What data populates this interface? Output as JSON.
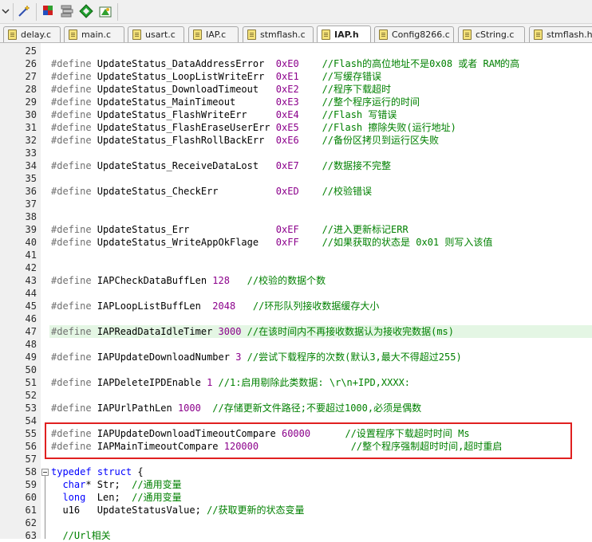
{
  "toolbar": {
    "icons": [
      "dropdown-arrow-icon",
      "magic-wand-icon",
      "download-flash-icon",
      "batch-build-icon",
      "green-diamond-icon",
      "manage-components-icon"
    ]
  },
  "tabs": [
    {
      "label": "delay.c",
      "active": false
    },
    {
      "label": "main.c",
      "active": false
    },
    {
      "label": "usart.c",
      "active": false
    },
    {
      "label": "IAP.c",
      "active": false
    },
    {
      "label": "stmflash.c",
      "active": false
    },
    {
      "label": "IAP.h",
      "active": true
    },
    {
      "label": "Config8266.c",
      "active": false
    },
    {
      "label": "cString.c",
      "active": false
    },
    {
      "label": "stmflash.h",
      "active": false
    }
  ],
  "editor": {
    "lines": [
      {
        "n": "25",
        "parts": []
      },
      {
        "n": "26",
        "parts": [
          [
            "pp",
            "#define "
          ],
          [
            "id",
            "UpdateStatus_DataAddressError  "
          ],
          [
            "nm",
            "0xE0"
          ],
          [
            "cm",
            "    //Flash的高位地址不是0x08 或者 RAM的高"
          ]
        ]
      },
      {
        "n": "27",
        "parts": [
          [
            "pp",
            "#define "
          ],
          [
            "id",
            "UpdateStatus_LoopListWriteErr  "
          ],
          [
            "nm",
            "0xE1"
          ],
          [
            "cm",
            "    //写缓存错误"
          ]
        ]
      },
      {
        "n": "28",
        "parts": [
          [
            "pp",
            "#define "
          ],
          [
            "id",
            "UpdateStatus_DownloadTimeout   "
          ],
          [
            "nm",
            "0xE2"
          ],
          [
            "cm",
            "    //程序下载超时"
          ]
        ]
      },
      {
        "n": "29",
        "parts": [
          [
            "pp",
            "#define "
          ],
          [
            "id",
            "UpdateStatus_MainTimeout       "
          ],
          [
            "nm",
            "0xE3"
          ],
          [
            "cm",
            "    //整个程序运行的时间"
          ]
        ]
      },
      {
        "n": "30",
        "parts": [
          [
            "pp",
            "#define "
          ],
          [
            "id",
            "UpdateStatus_FlashWriteErr     "
          ],
          [
            "nm",
            "0xE4"
          ],
          [
            "cm",
            "    //Flash 写错误"
          ]
        ]
      },
      {
        "n": "31",
        "parts": [
          [
            "pp",
            "#define "
          ],
          [
            "id",
            "UpdateStatus_FlashEraseUserErr "
          ],
          [
            "nm",
            "0xE5"
          ],
          [
            "cm",
            "    //Flash 擦除失败(运行地址)"
          ]
        ]
      },
      {
        "n": "32",
        "parts": [
          [
            "pp",
            "#define "
          ],
          [
            "id",
            "UpdateStatus_FlashRollBackErr  "
          ],
          [
            "nm",
            "0xE6"
          ],
          [
            "cm",
            "    //备份区拷贝到运行区失败"
          ]
        ]
      },
      {
        "n": "33",
        "parts": []
      },
      {
        "n": "34",
        "parts": [
          [
            "pp",
            "#define "
          ],
          [
            "id",
            "UpdateStatus_ReceiveDataLost   "
          ],
          [
            "nm",
            "0xE7"
          ],
          [
            "cm",
            "    //数据接不完整"
          ]
        ]
      },
      {
        "n": "35",
        "parts": []
      },
      {
        "n": "36",
        "parts": [
          [
            "pp",
            "#define "
          ],
          [
            "id",
            "UpdateStatus_CheckErr          "
          ],
          [
            "nm",
            "0xED"
          ],
          [
            "cm",
            "    //校验错误"
          ]
        ]
      },
      {
        "n": "37",
        "parts": []
      },
      {
        "n": "38",
        "parts": []
      },
      {
        "n": "39",
        "parts": [
          [
            "pp",
            "#define "
          ],
          [
            "id",
            "UpdateStatus_Err               "
          ],
          [
            "nm",
            "0xEF"
          ],
          [
            "cm",
            "    //进入更新标记ERR"
          ]
        ]
      },
      {
        "n": "40",
        "parts": [
          [
            "pp",
            "#define "
          ],
          [
            "id",
            "UpdateStatus_WriteAppOkFlage   "
          ],
          [
            "nm",
            "0xFF"
          ],
          [
            "cm",
            "    //如果获取的状态是 0x01 则写入该值"
          ]
        ]
      },
      {
        "n": "41",
        "parts": []
      },
      {
        "n": "42",
        "parts": []
      },
      {
        "n": "43",
        "parts": [
          [
            "pp",
            "#define "
          ],
          [
            "id",
            "IAPCheckDataBuffLen "
          ],
          [
            "nm",
            "128"
          ],
          [
            "cm",
            "   //校验的数据个数"
          ]
        ]
      },
      {
        "n": "44",
        "parts": []
      },
      {
        "n": "45",
        "parts": [
          [
            "pp",
            "#define "
          ],
          [
            "id",
            "IAPLoopListBuffLen  "
          ],
          [
            "nm",
            "2048"
          ],
          [
            "cm",
            "   //环形队列接收数据缓存大小"
          ]
        ]
      },
      {
        "n": "46",
        "parts": []
      },
      {
        "n": "47",
        "parts": [
          [
            "pp",
            "#define "
          ],
          [
            "id",
            "IAPReadDataIdleTimer "
          ],
          [
            "nm",
            "3000"
          ],
          [
            "cm",
            " //在该时间内不再接收数据认为接收完数据(ms)"
          ]
        ],
        "highlight": true
      },
      {
        "n": "48",
        "parts": []
      },
      {
        "n": "49",
        "parts": [
          [
            "pp",
            "#define "
          ],
          [
            "id",
            "IAPUpdateDownloadNumber "
          ],
          [
            "nm",
            "3"
          ],
          [
            "cm",
            " //尝试下载程序的次数(默认3,最大不得超过255)"
          ]
        ]
      },
      {
        "n": "50",
        "parts": []
      },
      {
        "n": "51",
        "parts": [
          [
            "pp",
            "#define "
          ],
          [
            "id",
            "IAPDeleteIPDEnable "
          ],
          [
            "nm",
            "1"
          ],
          [
            "cm",
            " //1:启用剔除此类数据: \\r\\n+IPD,XXXX:"
          ]
        ]
      },
      {
        "n": "52",
        "parts": []
      },
      {
        "n": "53",
        "parts": [
          [
            "pp",
            "#define "
          ],
          [
            "id",
            "IAPUrlPathLen "
          ],
          [
            "nm",
            "1000"
          ],
          [
            "cm",
            "  //存储更新文件路径;不要超过1000,必须是偶数"
          ]
        ]
      },
      {
        "n": "54",
        "parts": []
      },
      {
        "n": "55",
        "parts": [
          [
            "pp",
            "#define "
          ],
          [
            "id",
            "IAPUpdateDownloadTimeoutCompare "
          ],
          [
            "nm",
            "60000"
          ],
          [
            "cm",
            "      //设置程序下载超时时间 Ms"
          ]
        ]
      },
      {
        "n": "56",
        "parts": [
          [
            "pp",
            "#define "
          ],
          [
            "id",
            "IAPMainTimeoutCompare "
          ],
          [
            "nm",
            "120000"
          ],
          [
            "cm",
            "                //整个程序强制超时时间,超时重启"
          ]
        ]
      },
      {
        "n": "57",
        "parts": []
      },
      {
        "n": "58",
        "parts": [
          [
            "kw",
            "typedef"
          ],
          [
            "id",
            " "
          ],
          [
            "kw",
            "struct"
          ],
          [
            "id",
            " {"
          ]
        ],
        "fold": true
      },
      {
        "n": "59",
        "parts": [
          [
            "id",
            "  "
          ],
          [
            "kw",
            "char"
          ],
          [
            "id",
            "* Str;  "
          ],
          [
            "cm",
            "//通用变量"
          ]
        ]
      },
      {
        "n": "60",
        "parts": [
          [
            "id",
            "  "
          ],
          [
            "kw",
            "long"
          ],
          [
            "id",
            "  Len;  "
          ],
          [
            "cm",
            "//通用变量"
          ]
        ]
      },
      {
        "n": "61",
        "parts": [
          [
            "id",
            "  u16   UpdateStatusValue; "
          ],
          [
            "cm",
            "//获取更新的状态变量"
          ]
        ]
      },
      {
        "n": "62",
        "parts": []
      },
      {
        "n": "63",
        "parts": [
          [
            "cm",
            "  //Url相关"
          ]
        ]
      }
    ]
  }
}
